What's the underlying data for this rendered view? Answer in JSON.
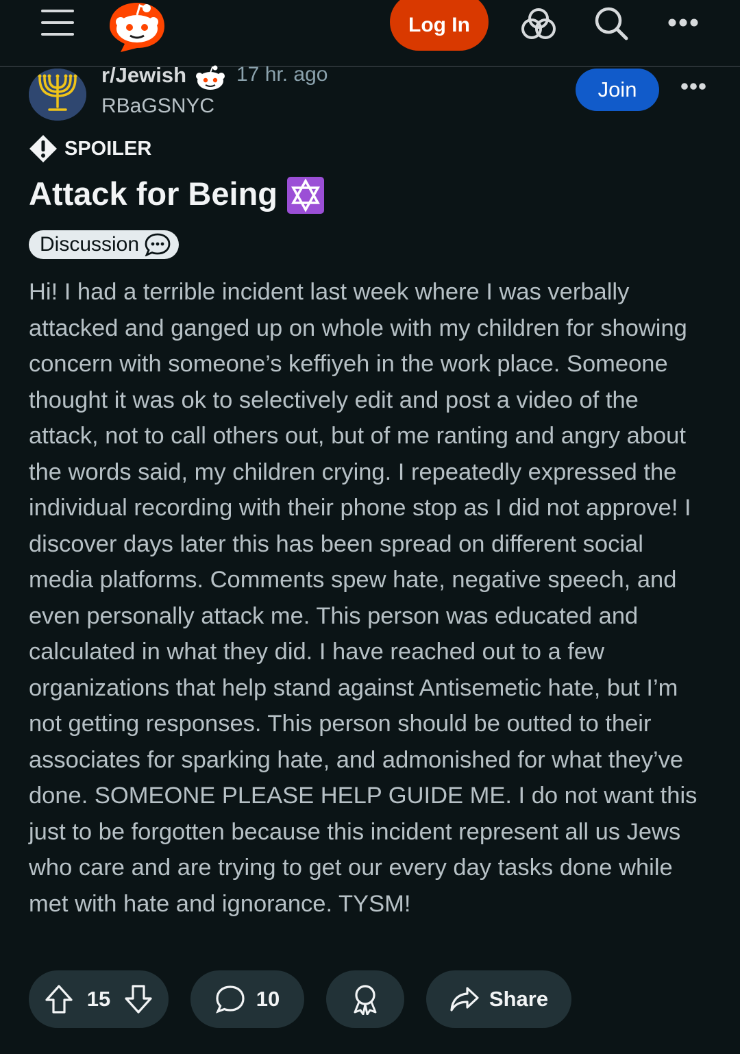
{
  "header": {
    "login_label": "Log In",
    "icons": [
      "menu-icon",
      "reddit-logo",
      "chat-icon",
      "search-icon",
      "more-icon"
    ]
  },
  "post": {
    "subreddit": "r/Jewish",
    "time_ago": "17 hr. ago",
    "author": "RBaGSNYC",
    "join_label": "Join",
    "spoiler_label": "SPOILER",
    "title": "Attack for Being",
    "title_emoji": "star-of-david-emoji",
    "flair": "Discussion",
    "body": "Hi! I had a terrible incident last week where I was verbally attacked and ganged up on whole with my children for showing concern with someone’s keffiyeh in the work place. Someone thought it was ok to selectively edit and post a video of the attack, not to call others out, but of me ranting and angry about the words said, my children crying. I repeatedly expressed the individual recording with their phone stop as I did not approve! I discover days later this has been spread on different social media platforms. Comments spew hate, negative speech, and even personally attack me. This person was educated and calculated in what they did. I have reached out to a few organizations that help stand against Antisemetic hate, but I’m not getting responses. This person should be outted to their associates for sparking hate, and admonished for what they’ve done. SOMEONE PLEASE HELP GUIDE ME. I do not want this just to be forgotten because this incident represent all us Jews who care and are trying to get our every day tasks done while met with hate and ignorance. TYSM!"
  },
  "actions": {
    "votes": "15",
    "comments": "10",
    "share_label": "Share"
  },
  "colors": {
    "background": "#0b1416",
    "login": "#d93900",
    "join": "#115bca",
    "pill": "#223237",
    "flair": "#e5ebee",
    "emoji_bg": "#9b4fd6"
  }
}
